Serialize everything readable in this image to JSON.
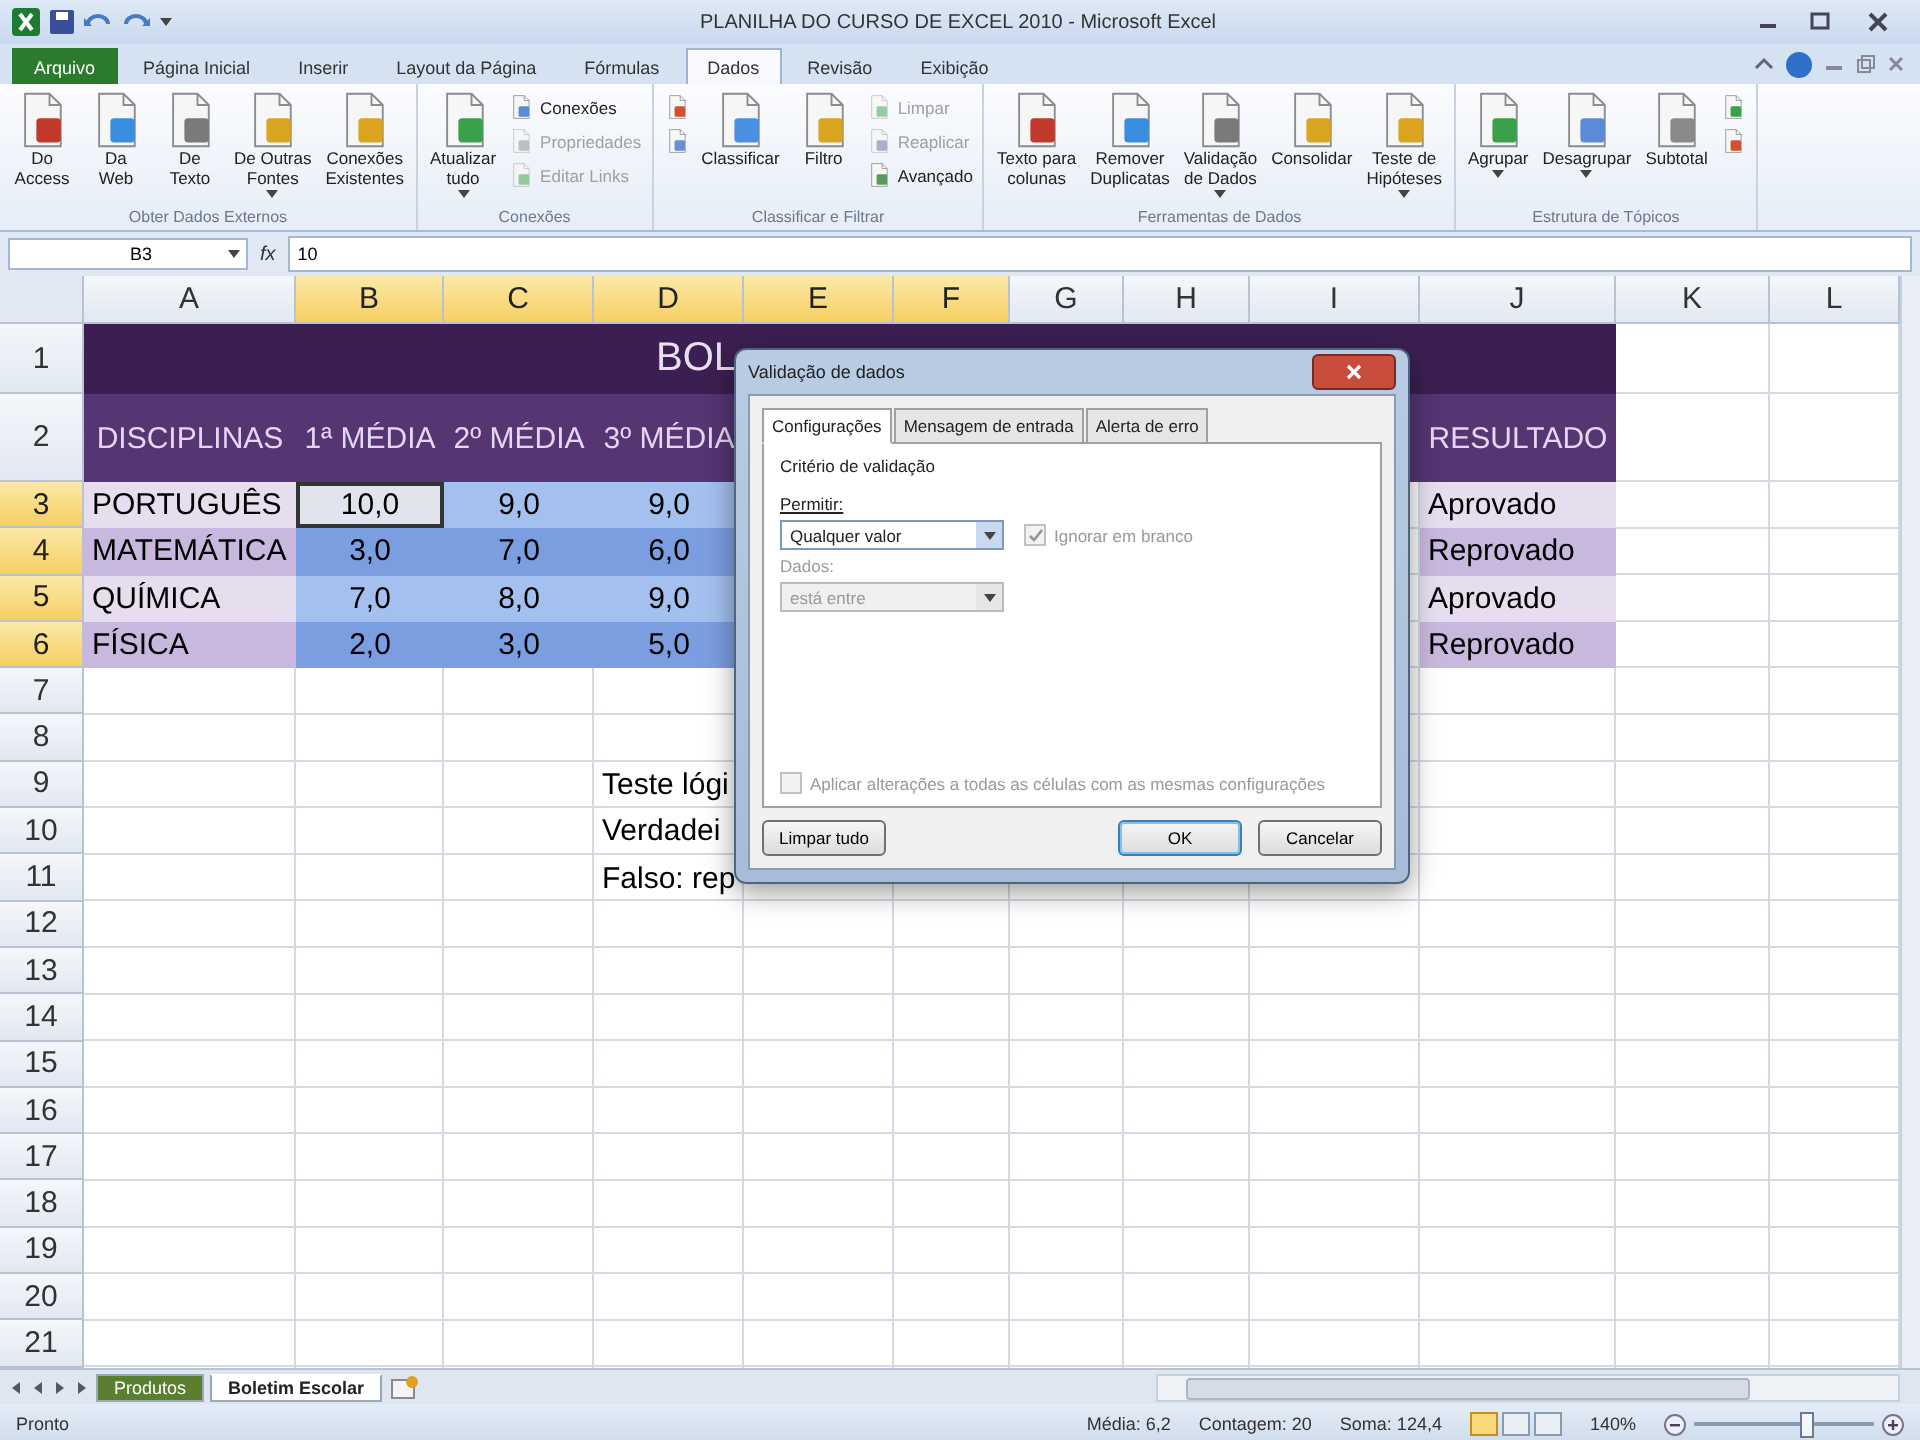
{
  "window": {
    "title": "PLANILHA DO CURSO DE EXCEL 2010 - Microsoft Excel"
  },
  "ribbon_tabs": [
    {
      "label": "Arquivo",
      "kind": "file",
      "selected": false
    },
    {
      "label": "Página Inicial",
      "kind": "tab",
      "selected": false
    },
    {
      "label": "Inserir",
      "kind": "tab",
      "selected": false
    },
    {
      "label": "Layout da Página",
      "kind": "tab",
      "selected": false
    },
    {
      "label": "Fórmulas",
      "kind": "tab",
      "selected": false
    },
    {
      "label": "Dados",
      "kind": "tab",
      "selected": true
    },
    {
      "label": "Revisão",
      "kind": "tab",
      "selected": false
    },
    {
      "label": "Exibição",
      "kind": "tab",
      "selected": false
    }
  ],
  "ribbon": {
    "groups": [
      {
        "title": "Obter Dados Externos",
        "buttons": [
          {
            "kind": "large",
            "label": "Do\nAccess",
            "dropdown": false,
            "disabled": false
          },
          {
            "kind": "large",
            "label": "Da\nWeb",
            "dropdown": false,
            "disabled": false
          },
          {
            "kind": "large",
            "label": "De\nTexto",
            "dropdown": false,
            "disabled": false
          },
          {
            "kind": "large",
            "label": "De Outras\nFontes",
            "dropdown": true,
            "disabled": false
          },
          {
            "kind": "large",
            "label": "Conexões\nExistentes",
            "dropdown": false,
            "disabled": false
          }
        ]
      },
      {
        "title": "Conexões",
        "buttons": [
          {
            "kind": "large",
            "label": "Atualizar\ntudo",
            "dropdown": true,
            "disabled": false
          },
          {
            "kind": "small",
            "label": "Conexões",
            "dropdown": false,
            "disabled": false
          },
          {
            "kind": "small",
            "label": "Propriedades",
            "dropdown": false,
            "disabled": true
          },
          {
            "kind": "small",
            "label": "Editar Links",
            "dropdown": false,
            "disabled": true
          }
        ]
      },
      {
        "title": "Classificar e Filtrar",
        "buttons": [
          {
            "kind": "icon",
            "dropdown": false,
            "disabled": false
          },
          {
            "kind": "icon",
            "dropdown": false,
            "disabled": false
          },
          {
            "kind": "large",
            "label": "Classificar",
            "dropdown": false,
            "disabled": false
          },
          {
            "kind": "large",
            "label": "Filtro",
            "dropdown": false,
            "disabled": false
          },
          {
            "kind": "small",
            "label": "Limpar",
            "dropdown": false,
            "disabled": true
          },
          {
            "kind": "small",
            "label": "Reaplicar",
            "dropdown": false,
            "disabled": true
          },
          {
            "kind": "small",
            "label": "Avançado",
            "dropdown": false,
            "disabled": false
          }
        ]
      },
      {
        "title": "Ferramentas de Dados",
        "buttons": [
          {
            "kind": "large",
            "label": "Texto para\ncolunas",
            "dropdown": false,
            "disabled": false
          },
          {
            "kind": "large",
            "label": "Remover\nDuplicatas",
            "dropdown": false,
            "disabled": false
          },
          {
            "kind": "large",
            "label": "Validação\nde Dados",
            "dropdown": true,
            "disabled": false
          },
          {
            "kind": "large",
            "label": "Consolidar",
            "dropdown": false,
            "disabled": false
          },
          {
            "kind": "large",
            "label": "Teste de\nHipóteses",
            "dropdown": true,
            "disabled": false
          }
        ]
      },
      {
        "title": "Estrutura de Tópicos",
        "buttons": [
          {
            "kind": "large",
            "label": "Agrupar",
            "dropdown": true,
            "disabled": false
          },
          {
            "kind": "large",
            "label": "Desagrupar",
            "dropdown": true,
            "disabled": false
          },
          {
            "kind": "large",
            "label": "Subtotal",
            "dropdown": false,
            "disabled": false
          },
          {
            "kind": "icon",
            "dropdown": false,
            "disabled": false
          },
          {
            "kind": "icon",
            "dropdown": false,
            "disabled": false
          }
        ]
      }
    ]
  },
  "formula_bar": {
    "name_box": "B3",
    "fx": "fx",
    "value": "10"
  },
  "columns": [
    {
      "label": "A",
      "selected": false
    },
    {
      "label": "B",
      "selected": true
    },
    {
      "label": "C",
      "selected": true
    },
    {
      "label": "D",
      "selected": true
    },
    {
      "label": "E",
      "selected": true
    },
    {
      "label": "F",
      "selected": true
    },
    {
      "label": "G",
      "selected": false
    },
    {
      "label": "H",
      "selected": false
    },
    {
      "label": "I",
      "selected": false
    },
    {
      "label": "J",
      "selected": false
    },
    {
      "label": "K",
      "selected": false
    },
    {
      "label": "L",
      "selected": false
    }
  ],
  "title_row": {
    "num": "1",
    "selected": false,
    "text": "BOL"
  },
  "header_row": {
    "num": "2",
    "selected": false,
    "headers": [
      "DISCIPLINAS",
      "1ª MÉDIA",
      "2º MÉDIA",
      "3º MÉDIA"
    ],
    "result_header": "RESULTADO"
  },
  "data_rows": [
    {
      "num": "3",
      "selected": true,
      "subject": "PORTUGUÊS",
      "grades": [
        {
          "value": "10,0",
          "active": true
        },
        {
          "value": "9,0",
          "active": false
        },
        {
          "value": "9,0",
          "active": false
        }
      ],
      "result": "Aprovado"
    },
    {
      "num": "4",
      "selected": true,
      "subject": "MATEMÁTICA",
      "grades": [
        {
          "value": "3,0",
          "active": false
        },
        {
          "value": "7,0",
          "active": false
        },
        {
          "value": "6,0",
          "active": false
        }
      ],
      "result": "Reprovado"
    },
    {
      "num": "5",
      "selected": true,
      "subject": "QUÍMICA",
      "grades": [
        {
          "value": "7,0",
          "active": false
        },
        {
          "value": "8,0",
          "active": false
        },
        {
          "value": "9,0",
          "active": false
        }
      ],
      "result": "Aprovado"
    },
    {
      "num": "6",
      "selected": true,
      "subject": "FÍSICA",
      "grades": [
        {
          "value": "2,0",
          "active": false
        },
        {
          "value": "3,0",
          "active": false
        },
        {
          "value": "5,0",
          "active": false
        }
      ],
      "result": "Reprovado"
    }
  ],
  "other_rows": [
    {
      "num": "7",
      "selected": false
    },
    {
      "num": "8",
      "selected": false
    },
    {
      "num": "9",
      "selected": false,
      "note": "Teste lógi"
    },
    {
      "num": "10",
      "selected": false,
      "note": "Verdadei"
    },
    {
      "num": "11",
      "selected": false,
      "note": "Falso: rep"
    },
    {
      "num": "12",
      "selected": false
    },
    {
      "num": "13",
      "selected": false
    },
    {
      "num": "14",
      "selected": false
    },
    {
      "num": "15",
      "selected": false
    },
    {
      "num": "16",
      "selected": false
    },
    {
      "num": "17",
      "selected": false
    },
    {
      "num": "18",
      "selected": false
    },
    {
      "num": "19",
      "selected": false
    },
    {
      "num": "20",
      "selected": false
    },
    {
      "num": "21",
      "selected": false
    }
  ],
  "dialog": {
    "title": "Validação de dados",
    "tabs": [
      {
        "label": "Configurações",
        "selected": true
      },
      {
        "label": "Mensagem de entrada",
        "selected": false
      },
      {
        "label": "Alerta de erro",
        "selected": false
      }
    ],
    "section": "Critério de validação",
    "allow_label": "Permitir:",
    "allow_value": "Qualquer valor",
    "ignore_blank": {
      "label": "Ignorar em branco",
      "checked": true,
      "disabled": true
    },
    "data_label": "Dados:",
    "data_value": "está entre",
    "data_disabled": true,
    "apply_all": {
      "label": "Aplicar alterações a todas as células com as mesmas configurações",
      "checked": false,
      "disabled": true
    },
    "buttons": [
      {
        "label": "Limpar tudo",
        "kind": "left"
      },
      {
        "label": "OK",
        "kind": "default"
      },
      {
        "label": "Cancelar",
        "kind": "normal"
      }
    ]
  },
  "sheet_tabs": [
    {
      "label": "Produtos",
      "selected": false,
      "color": "#5a7f2e"
    },
    {
      "label": "Boletim Escolar",
      "selected": true
    }
  ],
  "status_bar": {
    "ready": "Pronto",
    "stats": [
      "Média: 6,2",
      "Contagem: 20",
      "Soma: 124,4"
    ],
    "views": [
      {
        "selected": true
      },
      {
        "selected": false
      },
      {
        "selected": false
      }
    ],
    "zoom": "140%",
    "zoom_slider": {
      "level": 0.62
    }
  }
}
